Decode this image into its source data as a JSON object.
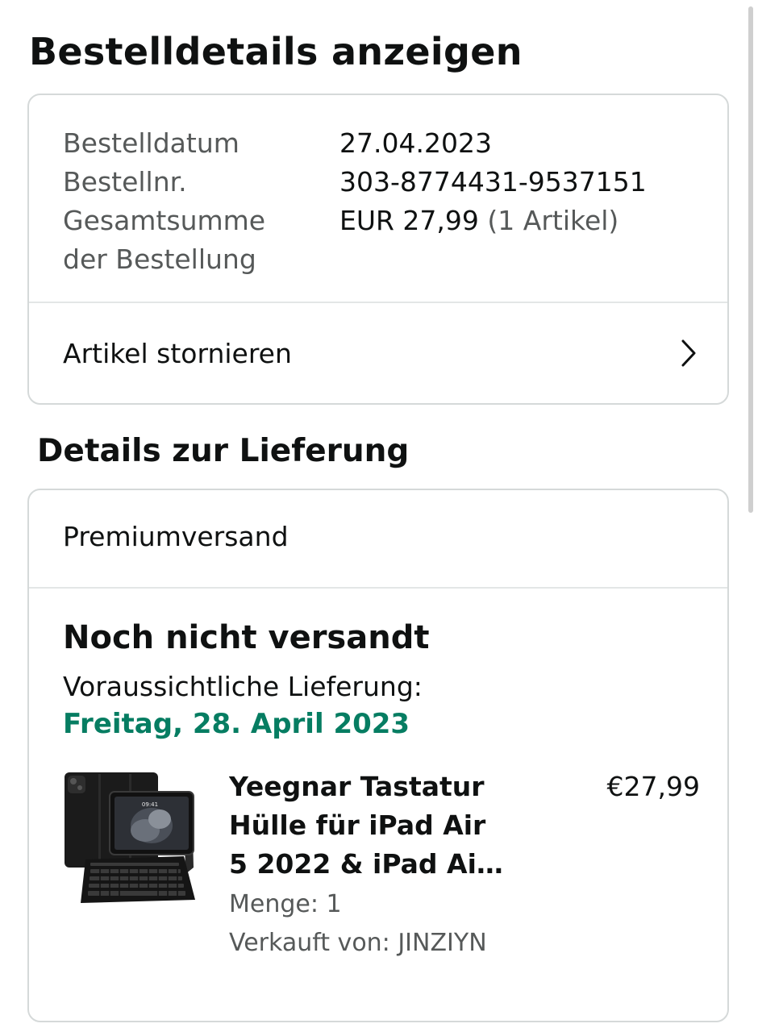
{
  "page": {
    "title": "Bestelldetails anzeigen"
  },
  "order_summary": {
    "rows": [
      {
        "label": "Bestelldatum",
        "value": "27.04.2023"
      },
      {
        "label": "Bestellnr.",
        "value": "303-8774431-9537151"
      },
      {
        "label": "Gesamtsumme der Bestellung",
        "value": "EUR 27,99",
        "value_note": "(1 Artikel)"
      }
    ],
    "cancel_label": "Artikel stornieren",
    "cancel_icon": "chevron-right-icon"
  },
  "delivery": {
    "section_title": "Details zur Lieferung",
    "shipping_speed": "Premiumversand",
    "status": "Noch nicht versandt",
    "eta_label": "Voraussichtliche Lieferung:",
    "eta_date": "Freitag, 28. April 2023",
    "eta_color": "#067d62",
    "item": {
      "title": "Yeegnar Tastatur Hülle für iPad Air 5 2022 & iPad Air 4...",
      "price": "€27,99",
      "quantity": "Menge: 1",
      "seller": "Verkauft von: JINZIYN",
      "image_label": "09:41",
      "image_icon": "tablet-keyboard-case-image"
    }
  },
  "colors": {
    "text": "#0f1111",
    "secondary_text": "#565959",
    "border": "#d5d9d9",
    "success_green": "#067d62"
  }
}
